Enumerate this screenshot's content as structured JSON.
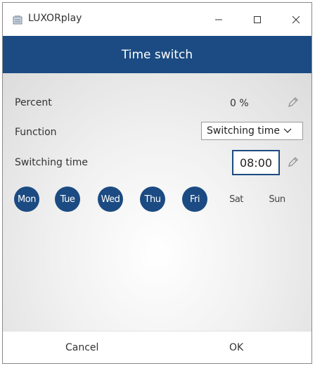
{
  "window": {
    "title": "LUXORplay"
  },
  "header": {
    "title": "Time switch"
  },
  "fields": {
    "percent_label": "Percent",
    "percent_value": "0 %",
    "function_label": "Function",
    "function_value": "Switching time",
    "switching_time_label": "Switching time",
    "switching_time_value": "08:00"
  },
  "days": [
    {
      "label": "Mon",
      "active": true
    },
    {
      "label": "Tue",
      "active": true
    },
    {
      "label": "Wed",
      "active": true
    },
    {
      "label": "Thu",
      "active": true
    },
    {
      "label": "Fri",
      "active": true
    },
    {
      "label": "Sat",
      "active": false
    },
    {
      "label": "Sun",
      "active": false
    }
  ],
  "footer": {
    "cancel_label": "Cancel",
    "ok_label": "OK"
  },
  "colors": {
    "accent": "#1b4b82",
    "header_text": "#ffffff"
  },
  "icons": {
    "app": "app-icon",
    "pencil": "pencil-icon",
    "chevron": "chevron-down-icon",
    "minimize": "minimize-icon",
    "maximize": "maximize-icon",
    "close": "close-icon"
  }
}
